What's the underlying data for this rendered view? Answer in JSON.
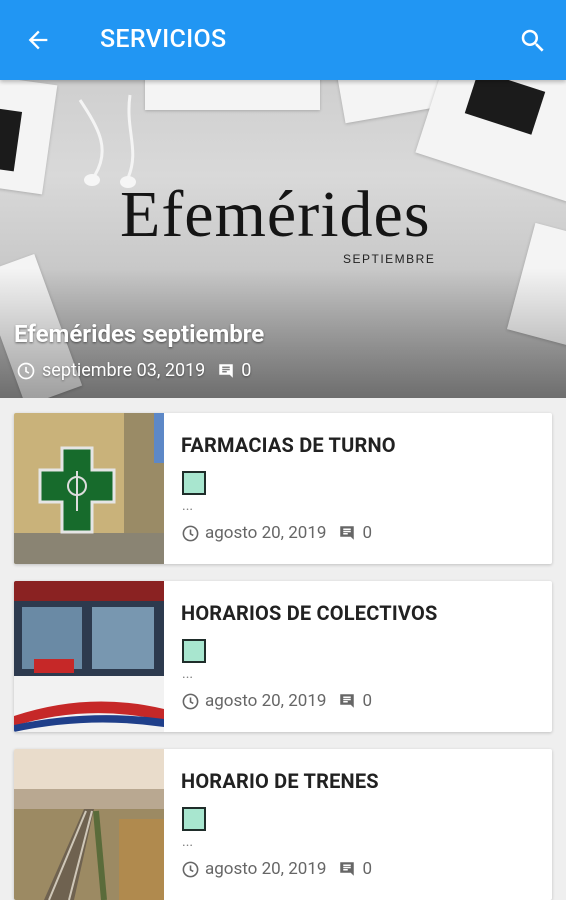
{
  "appbar": {
    "title": "SERVICIOS",
    "back_icon": "arrow-back-icon",
    "search_icon": "search-icon",
    "color": "#2196f3"
  },
  "hero": {
    "image_heading": "Efemérides",
    "image_subheading": "SEPTIEMBRE",
    "title": "Efemérides septiembre",
    "date": "septiembre 03, 2019",
    "comments": "0"
  },
  "posts": [
    {
      "title": "FARMACIAS DE TURNO",
      "excerpt": "...",
      "date": "agosto 20, 2019",
      "comments": "0"
    },
    {
      "title": "HORARIOS DE COLECTIVOS",
      "excerpt": "...",
      "date": "agosto 20, 2019",
      "comments": "0"
    },
    {
      "title": "HORARIO DE TRENES",
      "excerpt": "...",
      "date": "agosto 20, 2019",
      "comments": "0"
    }
  ],
  "colors": {
    "emoji_square": "#a8e6cf",
    "meta_text": "#666666"
  }
}
